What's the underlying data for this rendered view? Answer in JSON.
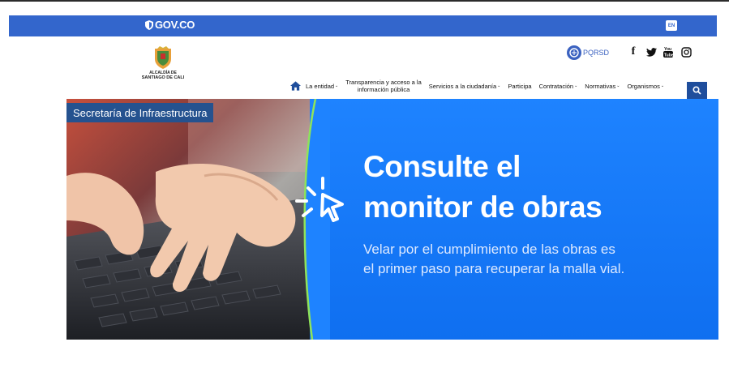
{
  "govbar": {
    "logo_text": "GOV.CO",
    "lang_label": "EN",
    "color": "#3366cc"
  },
  "header": {
    "city_line1": "ALCALDÍA DE",
    "city_line2": "SANTIAGO DE CALI",
    "pqrsd_label": "PQRSD",
    "social": [
      "facebook-icon",
      "twitter-icon",
      "youtube-icon",
      "instagram-icon"
    ]
  },
  "nav": {
    "items": [
      {
        "label": "La entidad",
        "caret": "⌄"
      },
      {
        "label_line1": "Transparencia y acceso a la",
        "label_line2": "información pública"
      },
      {
        "label": "Servicios a la ciudadanía",
        "caret": "⌄"
      },
      {
        "label": "Participa"
      },
      {
        "label": "Contratación",
        "caret": "⌄"
      },
      {
        "label": "Normativas",
        "caret": "⌄"
      },
      {
        "label": "Organismos",
        "caret": "⌄"
      }
    ]
  },
  "banner": {
    "section_label": "Secretaría de Infraestructura",
    "headline_line1": "Consulte el",
    "headline_line2": "monitor de obras",
    "sub_line1": "Velar por el cumplimiento de las obras es",
    "sub_line2": "el primer paso para recuperar la malla vial.",
    "accent": "#1e83ff",
    "label_bg": "#25528f"
  }
}
